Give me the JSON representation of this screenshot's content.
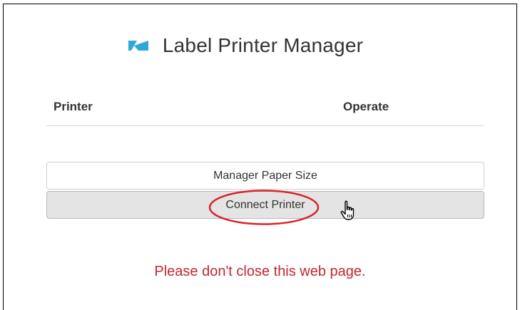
{
  "app": {
    "title": "Label Printer Manager",
    "logo_icon": "label-printer-logo-icon",
    "brand_color": "#2fa8d8"
  },
  "table": {
    "columns": [
      "Printer",
      "Operate"
    ]
  },
  "buttons": {
    "manager_paper_size": "Manager Paper Size",
    "connect_printer": "Connect Printer"
  },
  "annotation": {
    "highlight_color": "#d9232a",
    "cursor_icon": "hand-pointer-icon"
  },
  "warning": {
    "text": "Please don't close this web page.",
    "color": "#c0282f"
  }
}
